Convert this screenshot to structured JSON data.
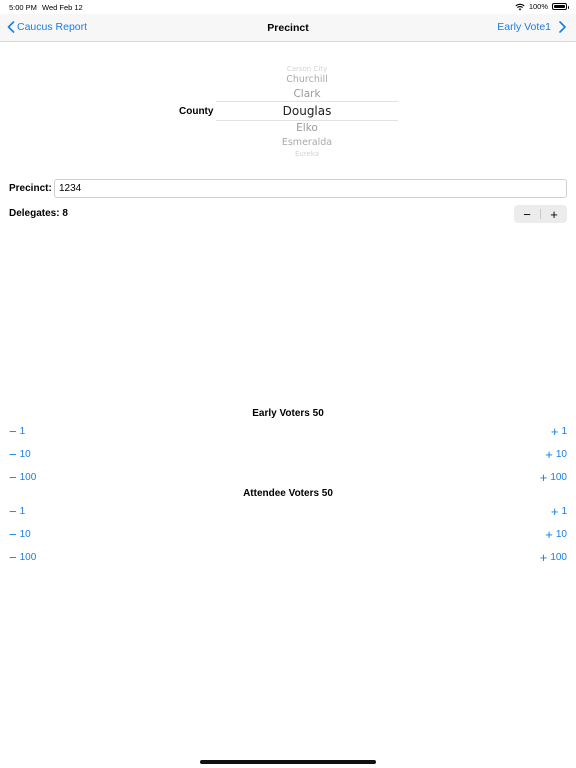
{
  "status_bar": {
    "time": "5:00 PM",
    "date": "Wed Feb 12",
    "battery": "100%"
  },
  "nav": {
    "back_label": "Caucus Report",
    "title": "Precinct",
    "forward_label": "Early Vote1"
  },
  "county": {
    "label": "County",
    "options": [
      "Carson City",
      "Churchill",
      "Clark",
      "Douglas",
      "Elko",
      "Esmeralda",
      "Eureka"
    ],
    "selected": "Douglas"
  },
  "precinct": {
    "label": "Precinct:",
    "value": "1234"
  },
  "delegates": {
    "label": "Delegates: 8",
    "minus": "−",
    "plus": "+"
  },
  "early_voters": {
    "title": "Early Voters 50",
    "decrements": [
      "1",
      "10",
      "100"
    ],
    "increments": [
      "1",
      "10",
      "100"
    ]
  },
  "attendee_voters": {
    "title": "Attendee Voters 50",
    "decrements": [
      "1",
      "10",
      "100"
    ],
    "increments": [
      "1",
      "10",
      "100"
    ]
  },
  "colors": {
    "accent": "#1a7ee0",
    "nav_bg": "#f7f7f7"
  }
}
